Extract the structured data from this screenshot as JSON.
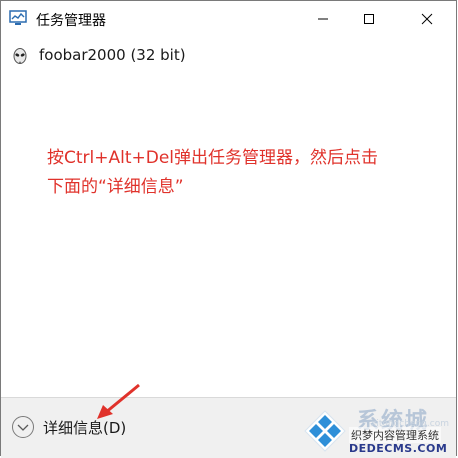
{
  "window": {
    "title": "任务管理器",
    "icon": "task-manager-icon"
  },
  "process": {
    "name": "foobar2000 (32 bit)",
    "icon": "foobar-alien-icon"
  },
  "annotation": {
    "line1": "按Ctrl+Alt+Del弹出任务管理器，然后点击",
    "line2": "下面的“详细信息”",
    "color": "#e0322b"
  },
  "footer": {
    "details_label": "详细信息(D)"
  },
  "watermark": {
    "brand": "系统城",
    "domain": "xitongcheng.com",
    "cn_text": "织梦内容管理系统",
    "cms": "DEDECMS.COM"
  }
}
